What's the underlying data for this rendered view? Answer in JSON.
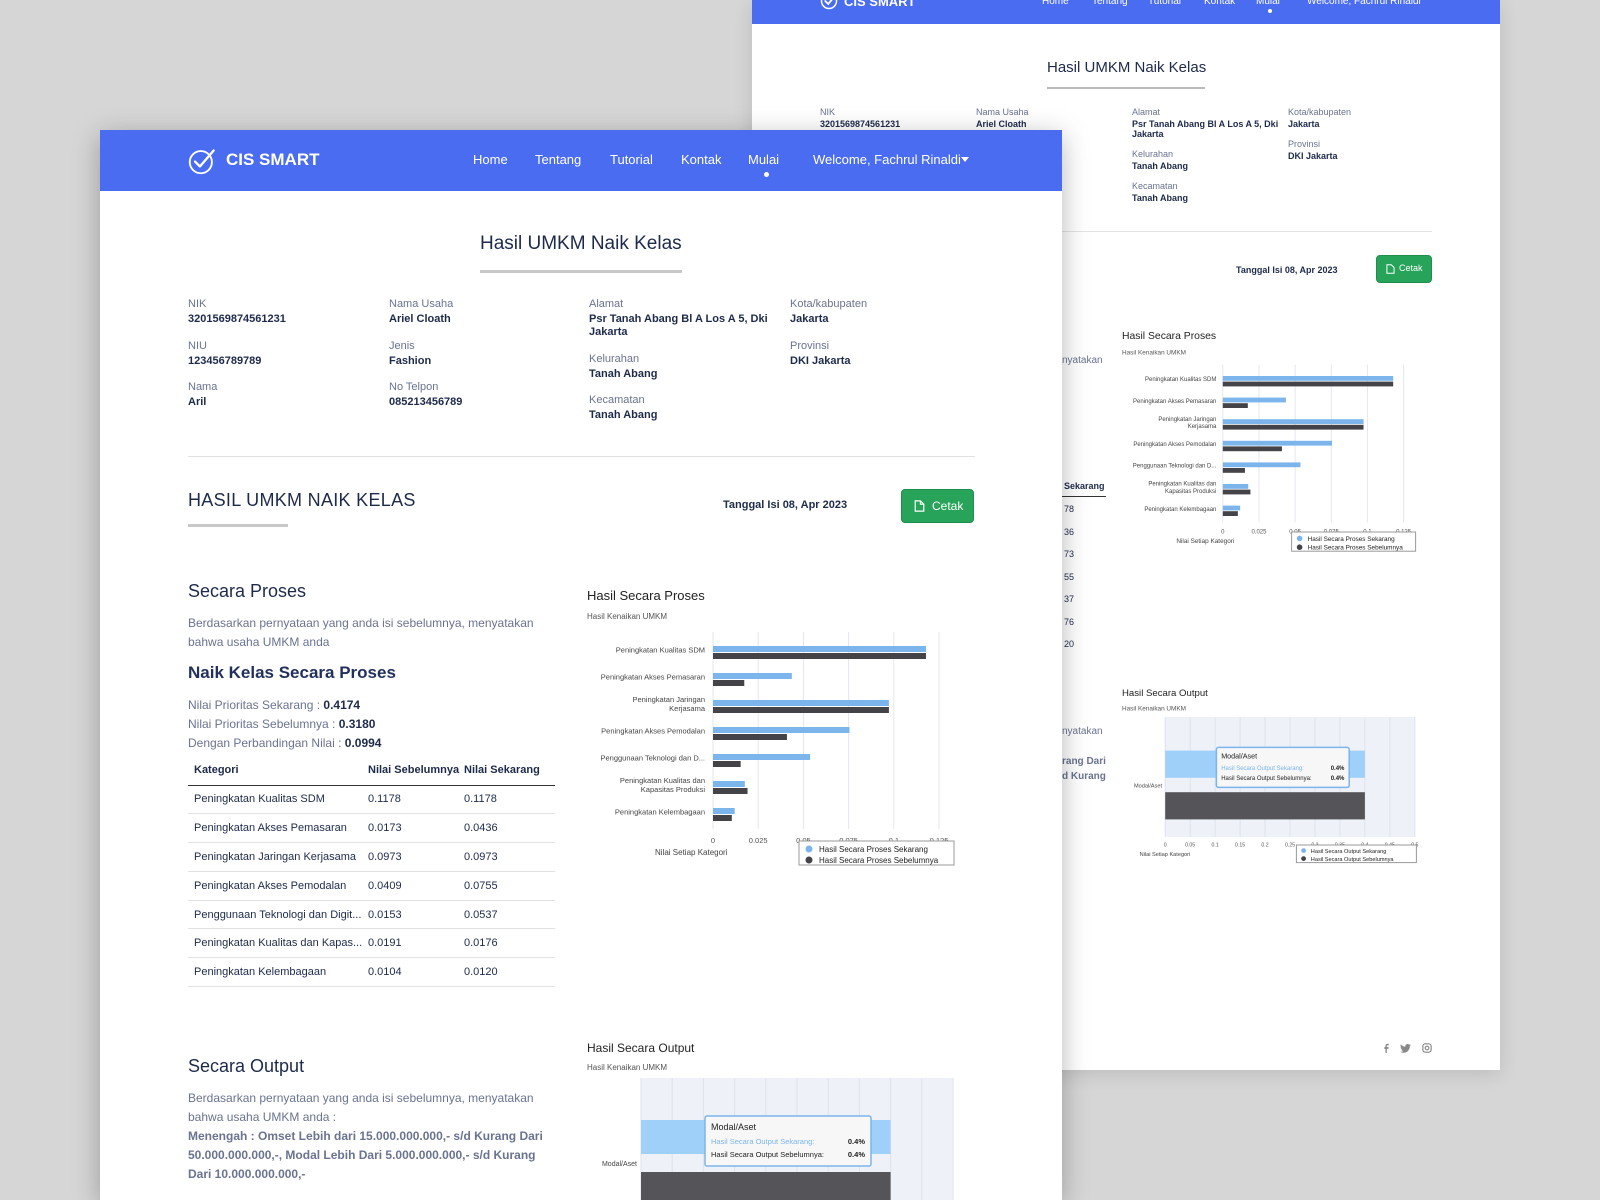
{
  "app": {
    "brand": "CIS SMART",
    "nav": [
      "Home",
      "Tentang",
      "Tutorial",
      "Kontak",
      "Mulai"
    ],
    "active_nav": "Mulai",
    "user_menu": "Welcome, Fachrul Rinaldi"
  },
  "page": {
    "title": "Hasil UMKM Naik Kelas"
  },
  "profile": {
    "nik_label": "NIK",
    "nik": "3201569874561231",
    "niu_label": "NIU",
    "niu": "123456789789",
    "nama_label": "Nama",
    "nama": "Aril",
    "nama_usaha_label": "Nama Usaha",
    "nama_usaha": "Ariel Cloath",
    "jenis_label": "Jenis",
    "jenis": "Fashion",
    "no_telpon_label": "No Telpon",
    "no_telpon": "085213456789",
    "alamat_label": "Alamat",
    "alamat_line1": "Psr Tanah Abang Bl A Los A 5, Dki",
    "alamat_line2": "Jakarta",
    "kelurahan_label": "Kelurahan",
    "kelurahan": "Tanah Abang",
    "kecamatan_label": "Kecamatan",
    "kecamatan": "Tanah Abang",
    "kota_label": "Kota/kabupaten",
    "kota": "Jakarta",
    "provinsi_label": "Provinsi",
    "provinsi": "DKI Jakarta"
  },
  "result": {
    "heading": "HASIL UMKM NAIK KELAS",
    "date": "Tanggal Isi 08, Apr 2023",
    "print_label": "Cetak"
  },
  "proses": {
    "title": "Secara Proses",
    "desc_line1": "Berdasarkan pernyataan yang anda isi sebelumnya, menyatakan",
    "desc_line2": "bahwa usaha UMKM anda",
    "verdict": "Naik Kelas Secara Proses",
    "now_label": "Nilai Prioritas Sekarang : ",
    "now_value": "0.4174",
    "prev_label": "Nilai Prioritas Sebelumnya : ",
    "prev_value": "0.3180",
    "cmp_label": "Dengan Perbandingan Nilai : ",
    "cmp_value": "0.0994",
    "table": {
      "headers": [
        "Kategori",
        "Nilai Sebelumnya",
        "Nilai Sekarang"
      ],
      "rows": [
        [
          "Peningkatan Kualitas SDM",
          "0.1178",
          "0.1178"
        ],
        [
          "Peningkatan Akses Pemasaran",
          "0.0173",
          "0.0436"
        ],
        [
          "Peningkatan Jaringan Kerjasama",
          "0.0973",
          "0.0973"
        ],
        [
          "Peningkatan Akses Pemodalan",
          "0.0409",
          "0.0755"
        ],
        [
          "Penggunaan Teknologi dan Digit...",
          "0.0153",
          "0.0537"
        ],
        [
          "Peningkatan Kualitas dan Kapas...",
          "0.0191",
          "0.0176"
        ],
        [
          "Peningkatan Kelembagaan",
          "0.0104",
          "0.0120"
        ]
      ]
    }
  },
  "output": {
    "title": "Secara Output",
    "desc_line1": "Berdasarkan pernyataan yang anda isi sebelumnya, menyatakan",
    "desc_line2": "bahwa usaha UMKM anda :",
    "verdict_line1": "Menengah : Omset Lebih dari 15.000.000.000,- s/d Kurang Dari",
    "verdict_line2": "50.000.000.000,-, Modal Lebih Dari 5.000.000.000,- s/d Kurang",
    "verdict_line3": "Dari 10.000.000.000,-"
  },
  "back_fragments": {
    "table_header": "Sekarang",
    "values": [
      "78",
      "36",
      "73",
      "55",
      "37",
      "76",
      "20"
    ],
    "text1": "nyatakan",
    "text2": "nyatakan",
    "text3": "rang Dari",
    "text4": "d Kurang"
  },
  "colors": {
    "accent": "#4a6cf0",
    "current": "#7cb5ec",
    "previous": "#434348",
    "print": "#27a35a"
  },
  "icons": [
    "check-circle-logo-icon",
    "caret-down-icon",
    "file-icon",
    "facebook-icon",
    "twitter-icon",
    "instagram-icon"
  ],
  "chart_data": [
    {
      "type": "bar",
      "orientation": "horizontal",
      "title": "Hasil Secara Proses",
      "subtitle": "Hasil Kenaikan UMKM",
      "xlabel": "Nilai Setiap Kategori",
      "categories": [
        "Peningkatan Kualitas SDM",
        "Peningkatan Akses Pemasaran",
        "Peningkatan Jaringan Kerjasama",
        "Peningkatan Akses Pemodalan",
        "Penggunaan Teknologi dan D...",
        "Peningkatan Kualitas dan Kapasitas Produksi",
        "Peningkatan Kelembagaan"
      ],
      "category_display": [
        [
          "Peningkatan Kualitas SDM"
        ],
        [
          "Peningkatan Akses Pemasaran"
        ],
        [
          "Peningkatan Jaringan",
          "Kerjasama"
        ],
        [
          "Peningkatan Akses Pemodalan"
        ],
        [
          "Penggunaan Teknologi dan D..."
        ],
        [
          "Peningkatan Kualitas dan",
          "Kapasitas Produksi"
        ],
        [
          "Peningkatan Kelembagaan"
        ]
      ],
      "series": [
        {
          "name": "Hasil Secara Proses Sekarang",
          "values": [
            0.1178,
            0.0436,
            0.0973,
            0.0755,
            0.0537,
            0.0176,
            0.012
          ]
        },
        {
          "name": "Hasil Secara Proses Sebelumnya",
          "values": [
            0.1178,
            0.0173,
            0.0973,
            0.0409,
            0.0153,
            0.0191,
            0.0104
          ]
        }
      ],
      "xlim": [
        0,
        0.125
      ],
      "ticks": [
        "0",
        "0.025",
        "0.05",
        "0.075",
        "0.1",
        "0.125"
      ],
      "grid": true,
      "legend": "bottom-right"
    },
    {
      "type": "bar",
      "orientation": "horizontal",
      "title": "Hasil Secara Output",
      "subtitle": "Hasil Kenaikan UMKM",
      "xlabel": "Nilai Setiap Kategori",
      "categories": [
        "Modal/Aset"
      ],
      "series": [
        {
          "name": "Hasil Secara Output Sekarang",
          "values": [
            0.4
          ]
        },
        {
          "name": "Hasil Secara Output Sebelumnya",
          "values": [
            0.4
          ]
        }
      ],
      "xlim": [
        0,
        0.5
      ],
      "ticks": [
        "0",
        "0.05",
        "0.1",
        "0.15",
        "0.2",
        "0.25",
        "0.3",
        "0.35",
        "0.4",
        "0.45",
        "0.5"
      ],
      "grid": true,
      "legend": "bottom-right",
      "tooltip": {
        "title": "Modal/Aset",
        "rows": [
          {
            "label": "Hasil Secara Output Sekarang:",
            "value": "0.4%"
          },
          {
            "label": "Hasil Secara Output Sebelumnya:",
            "value": "0.4%"
          }
        ]
      }
    }
  ]
}
